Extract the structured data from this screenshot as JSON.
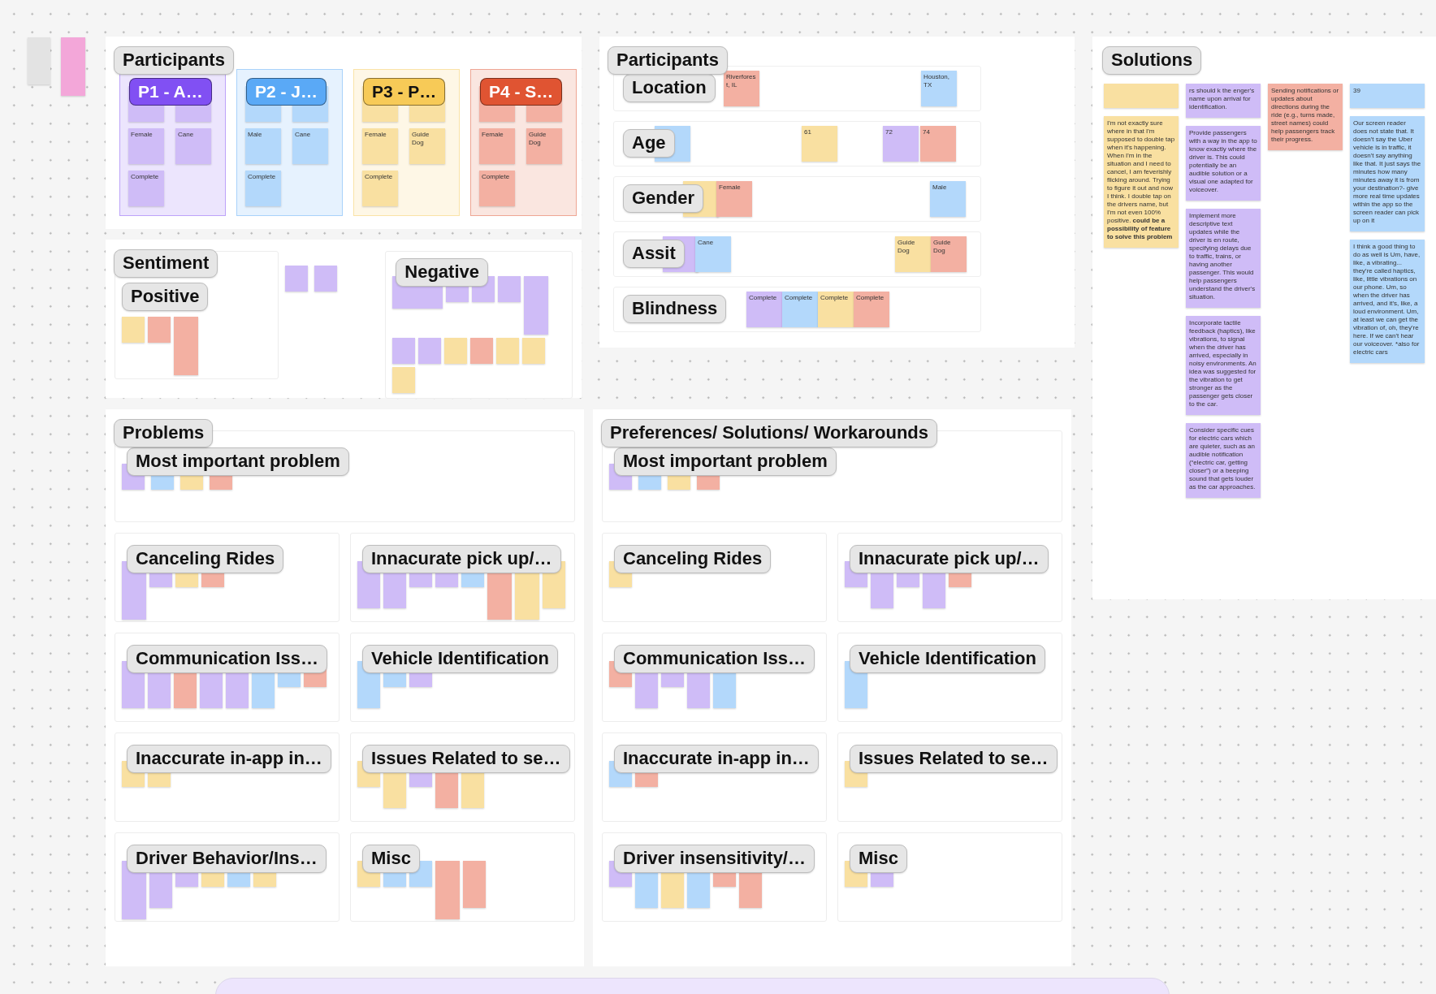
{
  "loose_notes": [
    {
      "color": "#e3e3e3",
      "kind": "tall"
    },
    {
      "color": "#f3a7d9",
      "kind": "long"
    }
  ],
  "participants_board": {
    "title": "Participants",
    "personas": [
      {
        "name": "P1 - A…",
        "color": "#8150f3",
        "notes": [
          {
            "color": "#cfbcf7"
          },
          {
            "color": "#cfbcf7"
          },
          {
            "color": "#cfbcf7",
            "text": "Female"
          },
          {
            "color": "#cfbcf7",
            "text": "Cane"
          },
          {
            "color": "#cfbcf7",
            "text": "Complete"
          }
        ]
      },
      {
        "name": "P2 - J…",
        "color": "#5aa9f6",
        "notes": [
          {
            "color": "#b3d8fb"
          },
          {
            "color": "#b3d8fb"
          },
          {
            "color": "#b3d8fb",
            "text": "Male"
          },
          {
            "color": "#b3d8fb",
            "text": "Cane"
          },
          {
            "color": "#b3d8fb",
            "text": "Complete"
          }
        ]
      },
      {
        "name": "P3 - P…",
        "color": "#f7ca57",
        "notes": [
          {
            "color": "#f9e0a1"
          },
          {
            "color": "#f9e0a1"
          },
          {
            "color": "#f9e0a1",
            "text": "Female"
          },
          {
            "color": "#f9e0a1",
            "text": "Guide Dog"
          },
          {
            "color": "#f9e0a1",
            "text": "Complete"
          }
        ]
      },
      {
        "name": "P4 - S…",
        "color": "#e05432",
        "notes": [
          {
            "color": "#f3b0a2"
          },
          {
            "color": "#f3b0a2"
          },
          {
            "color": "#f3b0a2",
            "text": "Female"
          },
          {
            "color": "#f3b0a2",
            "text": "Guide Dog"
          },
          {
            "color": "#f3b0a2",
            "text": "Complete"
          }
        ]
      }
    ]
  },
  "sentiment": {
    "title": "Sentiment",
    "positive": {
      "title": "Positive",
      "notes": [
        {
          "color": "#f9e0a1",
          "kind": "small"
        },
        {
          "color": "#f3b0a2",
          "kind": "small"
        },
        {
          "color": "#f3b0a2",
          "kind": "long"
        }
      ]
    },
    "loose_notes": [
      {
        "color": "#cfbcf7",
        "kind": "small"
      },
      {
        "color": "#cfbcf7",
        "kind": "small"
      }
    ],
    "negative": {
      "title": "Negative",
      "notes": [
        {
          "color": "#cfbcf7",
          "kind": "wide"
        },
        {
          "color": "#cfbcf7",
          "kind": "small"
        },
        {
          "color": "#cfbcf7",
          "kind": "small"
        },
        {
          "color": "#cfbcf7",
          "kind": "small"
        },
        {
          "color": "#cfbcf7",
          "kind": "long"
        },
        {
          "color": "#cfbcf7",
          "kind": "small"
        },
        {
          "color": "#cfbcf7",
          "kind": "small"
        },
        {
          "color": "#f9e0a1",
          "kind": "small"
        },
        {
          "color": "#f3b0a2",
          "kind": "small"
        },
        {
          "color": "#f9e0a1",
          "kind": "small"
        },
        {
          "color": "#f9e0a1",
          "kind": "small"
        },
        {
          "color": "#f9e0a1",
          "kind": "small"
        }
      ]
    }
  },
  "participant_attributes": {
    "title": "Participants",
    "rows": [
      {
        "label": "Location",
        "notes": [
          {
            "color": "#f3b0a2",
            "text": "Riverforest, IL"
          },
          {
            "color": "#b3d8fb",
            "text": "Houston, TX"
          }
        ]
      },
      {
        "label": "Age",
        "notes": [
          {
            "color": "#b3d8fb"
          },
          {
            "color": "#f9e0a1",
            "text": "61"
          },
          {
            "color": "#cfbcf7",
            "text": "72"
          },
          {
            "color": "#f3b0a2",
            "text": "74"
          }
        ]
      },
      {
        "label": "Gender",
        "notes": [
          {
            "color": "#f9e0a1"
          },
          {
            "color": "#f3b0a2",
            "text": "Female"
          },
          {
            "color": "#b3d8fb",
            "text": "Male"
          }
        ]
      },
      {
        "label": "Assit",
        "notes": [
          {
            "color": "#cfbcf7"
          },
          {
            "color": "#b3d8fb",
            "text": "Cane"
          },
          {
            "color": "#f9e0a1",
            "text": "Guide Dog"
          },
          {
            "color": "#f3b0a2",
            "text": "Guide Dog"
          }
        ]
      },
      {
        "label": "Blindness",
        "notes": [
          {
            "color": "#cfbcf7",
            "text": "Complete"
          },
          {
            "color": "#b3d8fb",
            "text": "Complete"
          },
          {
            "color": "#f9e0a1",
            "text": "Complete"
          },
          {
            "color": "#f3b0a2",
            "text": "Complete"
          }
        ]
      }
    ]
  },
  "solutions": {
    "title": "Solutions",
    "columns": [
      [
        {
          "color": "#f9e0a1",
          "kind": "stub"
        },
        {
          "color": "#f9e0a1",
          "text": "I'm not exactly sure where in that I'm supposed to double tap when it's happening. When I'm in the situation and I need to cancel, I am feverishly flicking around. Trying to figure it out and now I think. I double tap on the drivers name, but I'm not even 100% positive. **could be a possibility of feature to solve this problem**"
        }
      ],
      [
        {
          "color": "#cfbcf7",
          "text": "rs should k the enger's name upon arrival for identification."
        },
        {
          "color": "#cfbcf7",
          "text": "Provide passengers with a way in the app to know exactly where the driver is. This could potentially be an audible solution or a visual one adapted for voiceover."
        },
        {
          "color": "#cfbcf7",
          "text": "Implement more descriptive text updates while the driver is en route, specifying delays due to traffic, trains, or having another passenger. This would help passengers understand the driver's situation."
        },
        {
          "color": "#cfbcf7",
          "text": "Incorporate tactile feedback (haptics), like vibrations, to signal when the driver has arrived, especially in noisy environments. An idea was suggested for the vibration to get stronger as the passenger gets closer to the car."
        },
        {
          "color": "#cfbcf7",
          "text": "Consider specific cues for electric cars which are quieter, such as an audible notification (“electric car, getting closer”) or a beeping sound that gets louder as the car approaches."
        }
      ],
      [
        {
          "color": "#f3b0a2",
          "text": "Sending notifications or updates about directions during the ride (e.g., turns made, street names) could help passengers track their progress."
        }
      ],
      [
        {
          "color": "#b3d8fb",
          "text": "39",
          "kind": "stub"
        },
        {
          "color": "#b3d8fb",
          "text": "Our screen reader does not state that. It doesn't say the Uber vehicle is in traffic, it doesn't say anything like that. It just says the minutes how many minutes away it is from your destination?- give more real time updates within the app so the screen reader can pick up on it"
        },
        {
          "color": "#b3d8fb",
          "text": "I think a good thing to do as well is Um, have, like, a vibrating... they're called haptics, like, little vibrations on our phone. Um, so when the driver has arrived, and it's, like, a loud environment. Um, at least we can get the vibration of, oh, they're here. If we can't hear our voiceover. *also for electric cars"
        }
      ]
    ]
  },
  "problems": {
    "title": "Problems",
    "top": {
      "title": "Most important problem",
      "notes": [
        {
          "color": "#cfbcf7",
          "kind": "small"
        },
        {
          "color": "#b3d8fb",
          "kind": "small"
        },
        {
          "color": "#f9e0a1",
          "kind": "small"
        },
        {
          "color": "#f3b0a2",
          "kind": "small"
        }
      ]
    },
    "clusters": [
      {
        "title": "Canceling Rides",
        "notes": [
          {
            "color": "#cfbcf7",
            "kind": "long"
          },
          {
            "color": "#cfbcf7",
            "kind": "small"
          },
          {
            "color": "#f9e0a1",
            "kind": "small"
          },
          {
            "color": "#f3b0a2",
            "kind": "small"
          }
        ]
      },
      {
        "title": "Innacurate pick up/…",
        "notes": [
          {
            "color": "#cfbcf7",
            "kind": "tall"
          },
          {
            "color": "#cfbcf7",
            "kind": "tall"
          },
          {
            "color": "#cfbcf7",
            "kind": "small"
          },
          {
            "color": "#cfbcf7",
            "kind": "small"
          },
          {
            "color": "#b3d8fb",
            "kind": "small"
          },
          {
            "color": "#f3b0a2",
            "kind": "long"
          },
          {
            "color": "#f9e0a1",
            "kind": "long"
          },
          {
            "color": "#f9e0a1",
            "kind": "tall"
          }
        ]
      },
      {
        "title": "Communication Iss…",
        "notes": [
          {
            "color": "#cfbcf7",
            "kind": "tall"
          },
          {
            "color": "#cfbcf7",
            "kind": "tall"
          },
          {
            "color": "#f3b0a2",
            "kind": "tall"
          },
          {
            "color": "#cfbcf7",
            "kind": "tall"
          },
          {
            "color": "#cfbcf7",
            "kind": "tall"
          },
          {
            "color": "#b3d8fb",
            "kind": "tall"
          },
          {
            "color": "#b3d8fb",
            "kind": "small"
          },
          {
            "color": "#f3b0a2",
            "kind": "small"
          }
        ]
      },
      {
        "title": "Vehicle Identification",
        "notes": [
          {
            "color": "#b3d8fb",
            "kind": "tall"
          },
          {
            "color": "#b3d8fb",
            "kind": "small"
          },
          {
            "color": "#cfbcf7",
            "kind": "small"
          }
        ]
      },
      {
        "title": "Inaccurate in-app in…",
        "notes": [
          {
            "color": "#f9e0a1",
            "kind": "small"
          },
          {
            "color": "#f9e0a1",
            "kind": "small"
          }
        ]
      },
      {
        "title": "Issues Related to se…",
        "notes": [
          {
            "color": "#f9e0a1",
            "kind": "small"
          },
          {
            "color": "#f9e0a1",
            "kind": "tall"
          },
          {
            "color": "#cfbcf7",
            "kind": "small"
          },
          {
            "color": "#f3b0a2",
            "kind": "tall"
          },
          {
            "color": "#f9e0a1",
            "kind": "tall"
          }
        ]
      },
      {
        "title": "Driver Behavior/Ins…",
        "notes": [
          {
            "color": "#cfbcf7",
            "kind": "long"
          },
          {
            "color": "#cfbcf7",
            "kind": "tall"
          },
          {
            "color": "#cfbcf7",
            "kind": "small"
          },
          {
            "color": "#f9e0a1",
            "kind": "small"
          },
          {
            "color": "#b3d8fb",
            "kind": "small"
          },
          {
            "color": "#f9e0a1",
            "kind": "small"
          }
        ]
      },
      {
        "title": "Misc",
        "notes": [
          {
            "color": "#f9e0a1",
            "kind": "small"
          },
          {
            "color": "#b3d8fb",
            "kind": "small"
          },
          {
            "color": "#b3d8fb",
            "kind": "small"
          },
          {
            "color": "#f3b0a2",
            "kind": "long"
          },
          {
            "color": "#f3b0a2",
            "kind": "tall"
          }
        ]
      }
    ]
  },
  "preferences": {
    "title": "Preferences/ Solutions/ Workarounds",
    "top": {
      "title": "Most important problem",
      "notes": [
        {
          "color": "#cfbcf7",
          "kind": "small"
        },
        {
          "color": "#b3d8fb",
          "kind": "small"
        },
        {
          "color": "#f9e0a1",
          "kind": "small"
        },
        {
          "color": "#f3b0a2",
          "kind": "small"
        }
      ]
    },
    "clusters": [
      {
        "title": "Canceling Rides",
        "notes": [
          {
            "color": "#f9e0a1",
            "kind": "small"
          }
        ]
      },
      {
        "title": "Innacurate pick up/…",
        "notes": [
          {
            "color": "#cfbcf7",
            "kind": "small"
          },
          {
            "color": "#cfbcf7",
            "kind": "tall"
          },
          {
            "color": "#cfbcf7",
            "kind": "small"
          },
          {
            "color": "#cfbcf7",
            "kind": "tall"
          },
          {
            "color": "#f3b0a2",
            "kind": "small"
          }
        ]
      },
      {
        "title": "Communication Iss…",
        "notes": [
          {
            "color": "#f3b0a2",
            "kind": "small"
          },
          {
            "color": "#cfbcf7",
            "kind": "tall"
          },
          {
            "color": "#cfbcf7",
            "kind": "small"
          },
          {
            "color": "#cfbcf7",
            "kind": "tall"
          },
          {
            "color": "#b3d8fb",
            "kind": "tall"
          }
        ]
      },
      {
        "title": "Vehicle Identification",
        "notes": [
          {
            "color": "#b3d8fb",
            "kind": "tall"
          }
        ]
      },
      {
        "title": "Inaccurate in-app in…",
        "notes": [
          {
            "color": "#b3d8fb",
            "kind": "small"
          },
          {
            "color": "#f3b0a2",
            "kind": "small"
          }
        ]
      },
      {
        "title": "Issues Related to se…",
        "notes": [
          {
            "color": "#f9e0a1",
            "kind": "small"
          }
        ]
      },
      {
        "title": "Driver insensitivity/…",
        "notes": [
          {
            "color": "#cfbcf7",
            "kind": "small"
          },
          {
            "color": "#b3d8fb",
            "kind": "tall"
          },
          {
            "color": "#f9e0a1",
            "kind": "tall"
          },
          {
            "color": "#b3d8fb",
            "kind": "tall"
          },
          {
            "color": "#f3b0a2",
            "kind": "small"
          },
          {
            "color": "#f3b0a2",
            "kind": "tall"
          }
        ]
      },
      {
        "title": "Misc",
        "notes": [
          {
            "color": "#f9e0a1",
            "kind": "small"
          },
          {
            "color": "#cfbcf7",
            "kind": "small"
          }
        ]
      }
    ]
  }
}
